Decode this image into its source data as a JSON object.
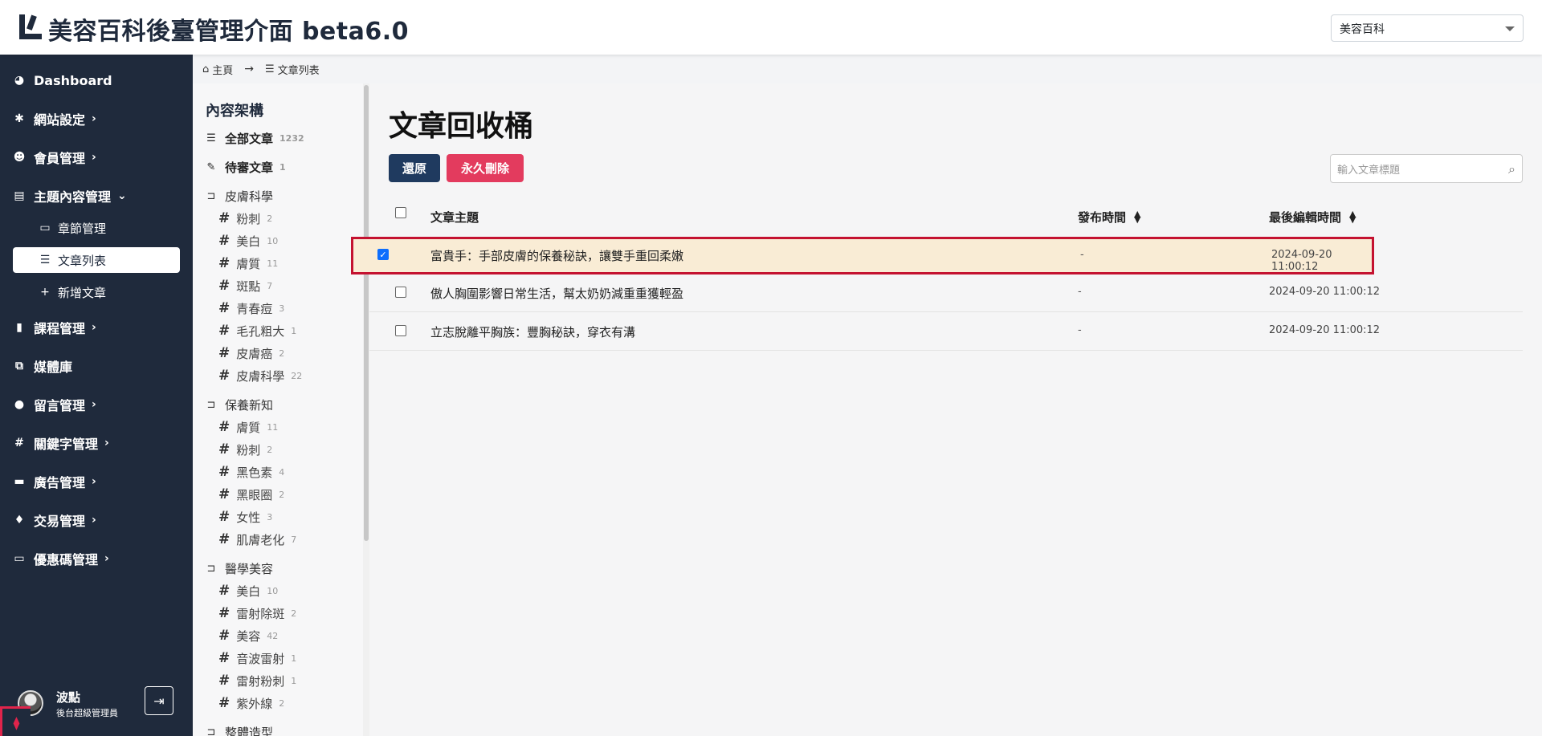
{
  "header": {
    "title": "美容百科後臺管理介面 beta6.0",
    "site_select": "美容百科"
  },
  "sidebar": {
    "items": [
      {
        "label": "Dashboard",
        "icon": "dashboard-icon"
      },
      {
        "label": "網站設定",
        "icon": "gear-icon"
      },
      {
        "label": "會員管理",
        "icon": "users-icon"
      },
      {
        "label": "主題內容管理",
        "icon": "content-icon"
      },
      {
        "label": "章節管理",
        "icon": "chapter-icon"
      },
      {
        "label": "文章列表",
        "icon": "list-icon"
      },
      {
        "label": "新增文章",
        "icon": "plus-icon"
      },
      {
        "label": "課程管理",
        "icon": "book-icon"
      },
      {
        "label": "媒體庫",
        "icon": "images-icon"
      },
      {
        "label": "留言管理",
        "icon": "comment-icon"
      },
      {
        "label": "關鍵字管理",
        "icon": "hashtag-icon"
      },
      {
        "label": "廣告管理",
        "icon": "ad-icon"
      },
      {
        "label": "交易管理",
        "icon": "money-bag-icon"
      },
      {
        "label": "優惠碼管理",
        "icon": "ticket-icon"
      }
    ],
    "user": {
      "name": "波點",
      "role": "後台超級管理員"
    }
  },
  "breadcrumb": {
    "home": "主頁",
    "current": "文章列表"
  },
  "categories": {
    "heading": "內容架構",
    "all": {
      "label": "全部文章",
      "count": "1232"
    },
    "pending": {
      "label": "待審文章",
      "count": "1"
    },
    "groups": [
      {
        "name": "皮膚科學",
        "tags": [
          {
            "label": "粉刺",
            "count": "2"
          },
          {
            "label": "美白",
            "count": "10"
          },
          {
            "label": "膚質",
            "count": "11"
          },
          {
            "label": "斑點",
            "count": "7"
          },
          {
            "label": "青春痘",
            "count": "3"
          },
          {
            "label": "毛孔粗大",
            "count": "1"
          },
          {
            "label": "皮膚癌",
            "count": "2"
          },
          {
            "label": "皮膚科學",
            "count": "22"
          }
        ]
      },
      {
        "name": "保養新知",
        "tags": [
          {
            "label": "膚質",
            "count": "11"
          },
          {
            "label": "粉刺",
            "count": "2"
          },
          {
            "label": "黑色素",
            "count": "4"
          },
          {
            "label": "黑眼圈",
            "count": "2"
          },
          {
            "label": "女性",
            "count": "3"
          },
          {
            "label": "肌膚老化",
            "count": "7"
          }
        ]
      },
      {
        "name": "醫學美容",
        "tags": [
          {
            "label": "美白",
            "count": "10"
          },
          {
            "label": "雷射除斑",
            "count": "2"
          },
          {
            "label": "美容",
            "count": "42"
          },
          {
            "label": "音波雷射",
            "count": "1"
          },
          {
            "label": "雷射粉刺",
            "count": "1"
          },
          {
            "label": "紫外線",
            "count": "2"
          }
        ]
      },
      {
        "name": "整體造型",
        "tags": []
      }
    ]
  },
  "main": {
    "title": "文章回收桶",
    "restore_label": "還原",
    "delete_label": "永久刪除",
    "search_placeholder": "輸入文章標題",
    "columns": {
      "subject": "文章主題",
      "published": "發布時間",
      "edited": "最後編輯時間"
    },
    "rows": [
      {
        "title": "富貴手：手部皮膚的保養秘訣，讓雙手重回柔嫩",
        "published": "-",
        "edited": "2024-09-20 11:00:12",
        "checked": true
      },
      {
        "title": "傲人胸圍影響日常生活，幫太奶奶減重重獲輕盈",
        "published": "-",
        "edited": "2024-09-20 11:00:12",
        "checked": false
      },
      {
        "title": "立志脫離平胸族：豐胸秘訣，穿衣有溝",
        "published": "-",
        "edited": "2024-09-20 11:00:12",
        "checked": false
      }
    ]
  },
  "colors": {
    "sidebar_bg": "#1f2a3c",
    "restore_button": "#1f3a5f",
    "delete_button": "#e33b5e",
    "selected_row_bg": "#f9ecd5",
    "selected_row_border": "#c41230"
  }
}
